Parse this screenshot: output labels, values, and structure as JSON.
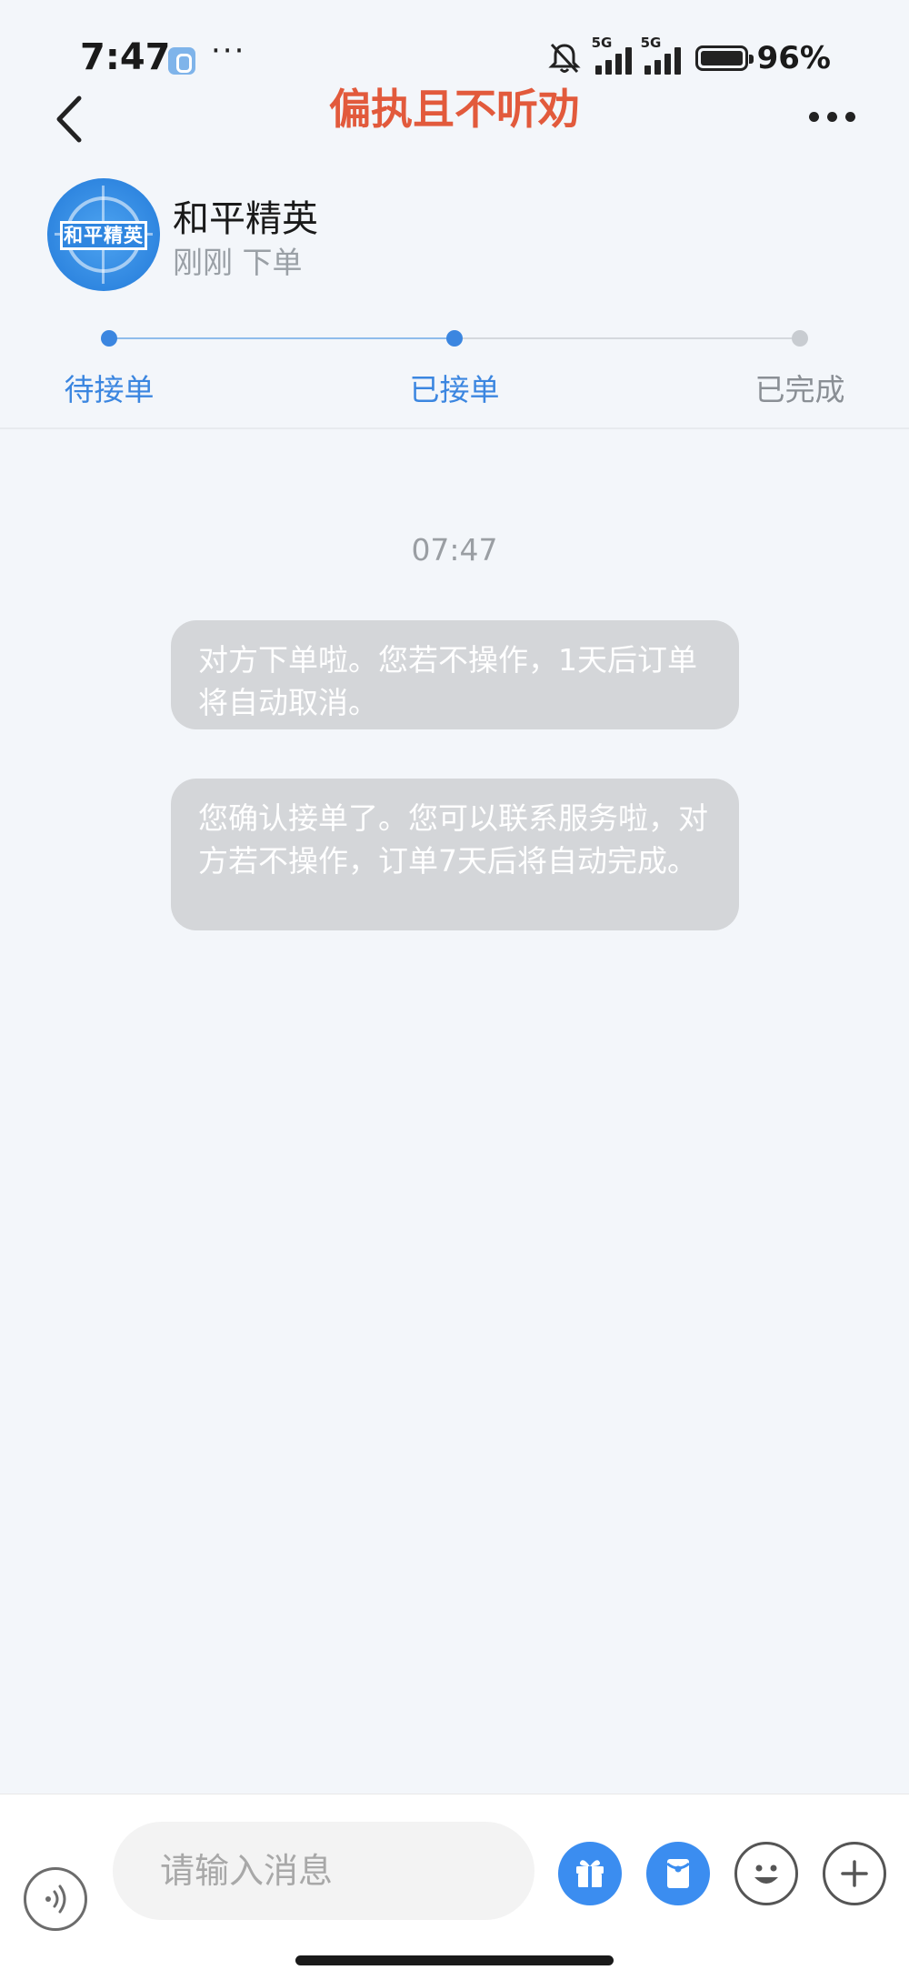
{
  "status_bar": {
    "time": "7:47",
    "more": "···",
    "network_1": "5G",
    "network_2": "5G",
    "battery_text": "96%"
  },
  "nav": {
    "title": "偏执且不听劝",
    "back_icon": "chevron-left-icon",
    "more_icon": "more-horizontal-icon"
  },
  "order": {
    "logo_text": "和平精英",
    "game_name": "和平精英",
    "meta": "刚刚 下单"
  },
  "progress": {
    "steps": [
      {
        "label": "待接单",
        "state": "done",
        "color": "#3b86e0"
      },
      {
        "label": "已接单",
        "state": "current",
        "color": "#3b86e0"
      },
      {
        "label": "已完成",
        "state": "pending",
        "color": "#8a8f95"
      }
    ]
  },
  "chat": {
    "time": "07:47",
    "messages": [
      {
        "text": "对方下单啦。您若不操作，1天后订单将自动取消。"
      },
      {
        "text": "您确认接单了。您可以联系服务啦，对方若不操作，订单7天后将自动完成。"
      }
    ]
  },
  "input_bar": {
    "placeholder": "请输入消息",
    "value": "",
    "icons": [
      "voice-icon",
      "gift-icon",
      "red-packet-icon",
      "emoji-icon",
      "plus-icon"
    ]
  }
}
